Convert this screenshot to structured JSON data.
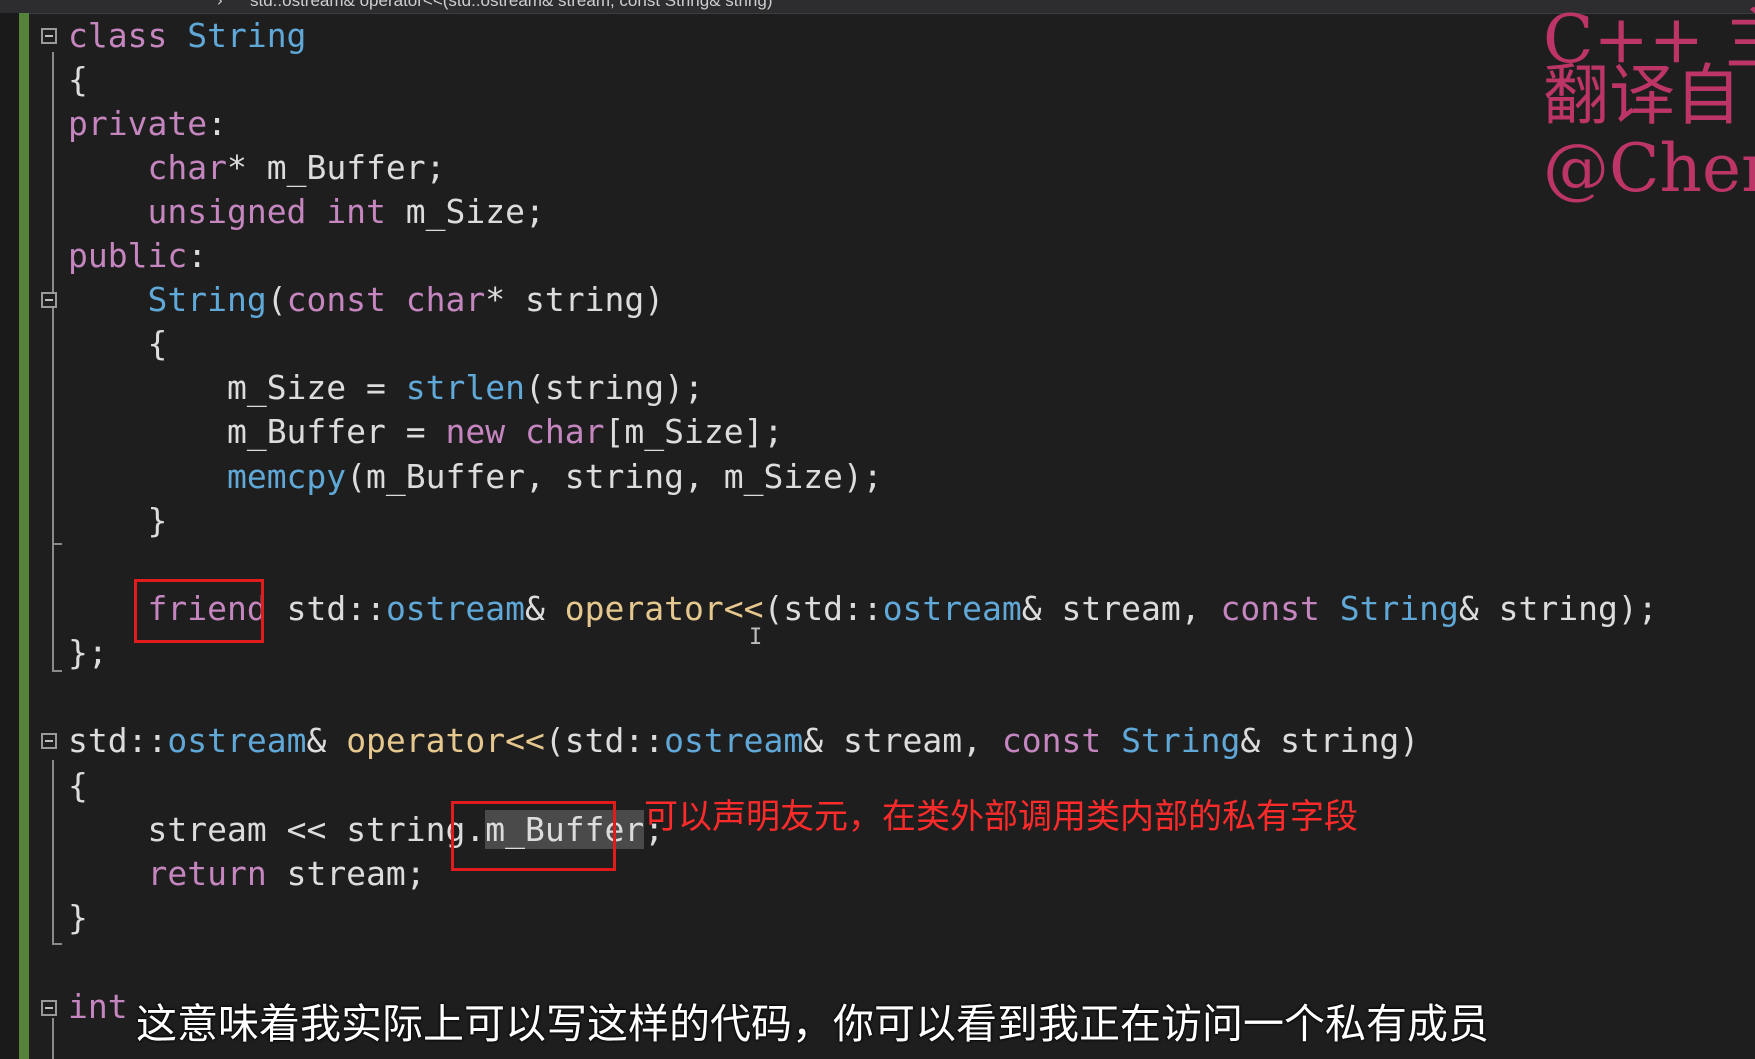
{
  "editor": {
    "breadcrumb": "std::ostream& operator<<(std::ostream& stream, const String& string)",
    "lines": {
      "l1": [
        "class",
        " ",
        "String"
      ],
      "l2": [
        "{"
      ],
      "l3": [
        "private",
        ":"
      ],
      "l4": [
        "    ",
        "char",
        "* ",
        "m_Buffer",
        ";"
      ],
      "l5": [
        "    ",
        "unsigned",
        " ",
        "int",
        " ",
        "m_Size",
        ";"
      ],
      "l6": [
        "public",
        ":"
      ],
      "l7": [
        "    ",
        "String",
        "(",
        "const",
        " ",
        "char",
        "* ",
        "string",
        ")"
      ],
      "l8": [
        "    {"
      ],
      "l9": [
        "        ",
        "m_Size",
        " = ",
        "strlen",
        "(",
        "string",
        ");"
      ],
      "l10": [
        "        ",
        "m_Buffer",
        " = ",
        "new",
        " ",
        "char",
        "[",
        "m_Size",
        "];"
      ],
      "l11": [
        "        ",
        "memcpy",
        "(",
        "m_Buffer",
        ", ",
        "string",
        ", ",
        "m_Size",
        ");"
      ],
      "l12": [
        "    }"
      ],
      "l13": [
        "    ",
        "friend",
        " ",
        "std",
        "::",
        "ostream",
        "& ",
        "operator<<",
        "(",
        "std",
        "::",
        "ostream",
        "& ",
        "stream",
        ", ",
        "const",
        " ",
        "String",
        "& ",
        "string",
        ");"
      ],
      "l14": [
        "};"
      ],
      "l15": [
        "std",
        "::",
        "ostream",
        "& ",
        "operator<<",
        "(",
        "std",
        "::",
        "ostream",
        "& ",
        "stream",
        ", ",
        "const",
        " ",
        "String",
        "& ",
        "string",
        ")"
      ],
      "l16": [
        "{"
      ],
      "l17": [
        "    ",
        "stream",
        " << ",
        "string",
        ".",
        "m_Buffer",
        ";"
      ],
      "l18": [
        "    ",
        "return",
        " ",
        "stream",
        ";"
      ],
      "l19": [
        "}"
      ],
      "l20": [
        "int"
      ]
    }
  },
  "annotation": "可以声明友元，在类外部调用类内部的私有字段",
  "subtitle": "这意味着我实际上可以写这样的代码，你可以看到我正在访问一个私有成员",
  "watermark": {
    "line1": "C++ 主",
    "line2": "翻译自",
    "line3": "@Cherr"
  },
  "colors": {
    "keyword": "#c586c0",
    "type": "#4ec9b0",
    "highlight_box": "#e01c1c",
    "annotation": "#ff2b2b",
    "margin_green": "#56833b"
  }
}
